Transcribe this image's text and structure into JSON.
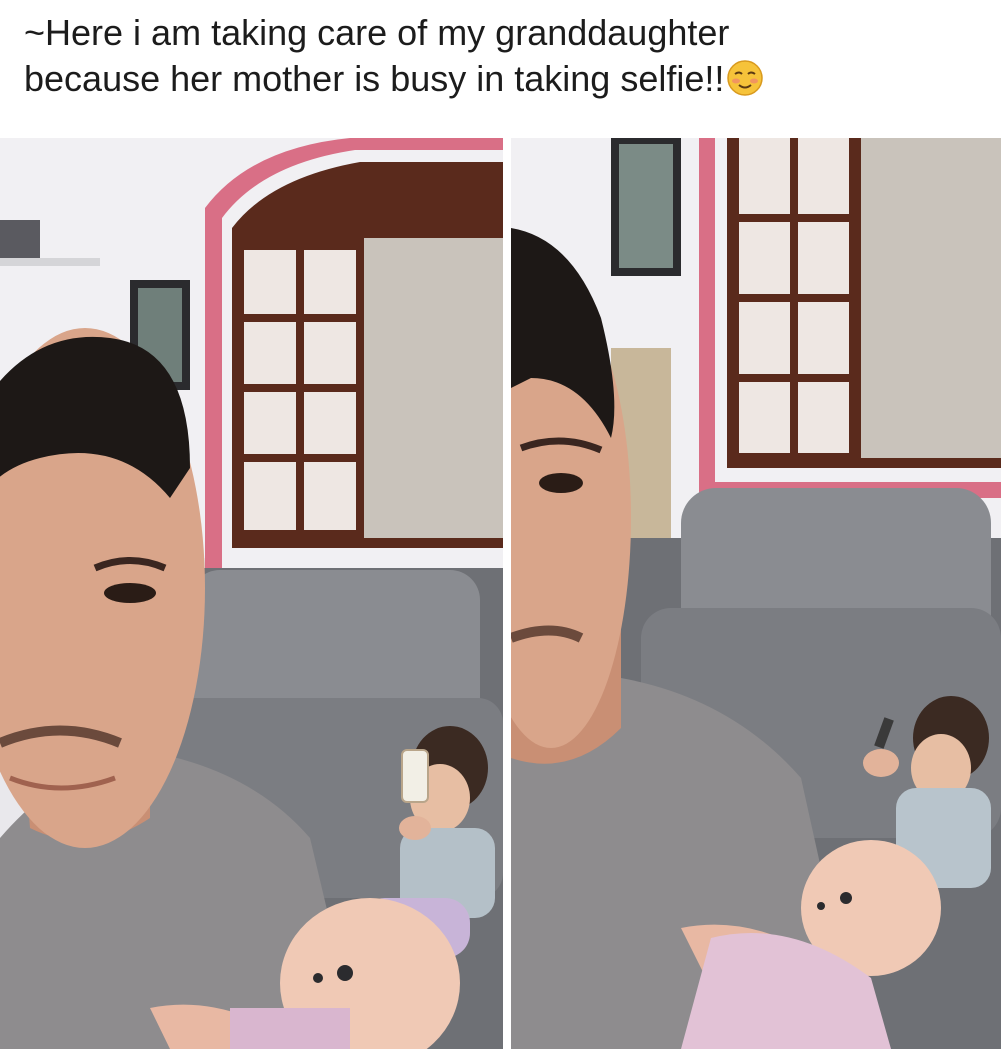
{
  "post": {
    "caption_line_1": "~Here i am taking care of my granddaughter",
    "caption_line_2": "because her mother is busy in taking selfie!!",
    "caption_emoji": "relieved-face-emoji"
  },
  "photos": [
    {
      "name": "selfie-left",
      "scene": "man-selfie-with-baby-doll-and-child-on-sofa"
    },
    {
      "name": "selfie-right",
      "scene": "man-selfie-with-baby-doll-and-child-on-sofa"
    }
  ],
  "colors": {
    "wall": "#e7e6ea",
    "window_frame": "#5a2a1c",
    "window_trim": "#d96f86",
    "sofa": "#7d7f84",
    "shirt": "#8e8c8e",
    "skin": "#d9a58a",
    "hair": "#1d1816",
    "doll_skin": "#f0c9b5"
  }
}
